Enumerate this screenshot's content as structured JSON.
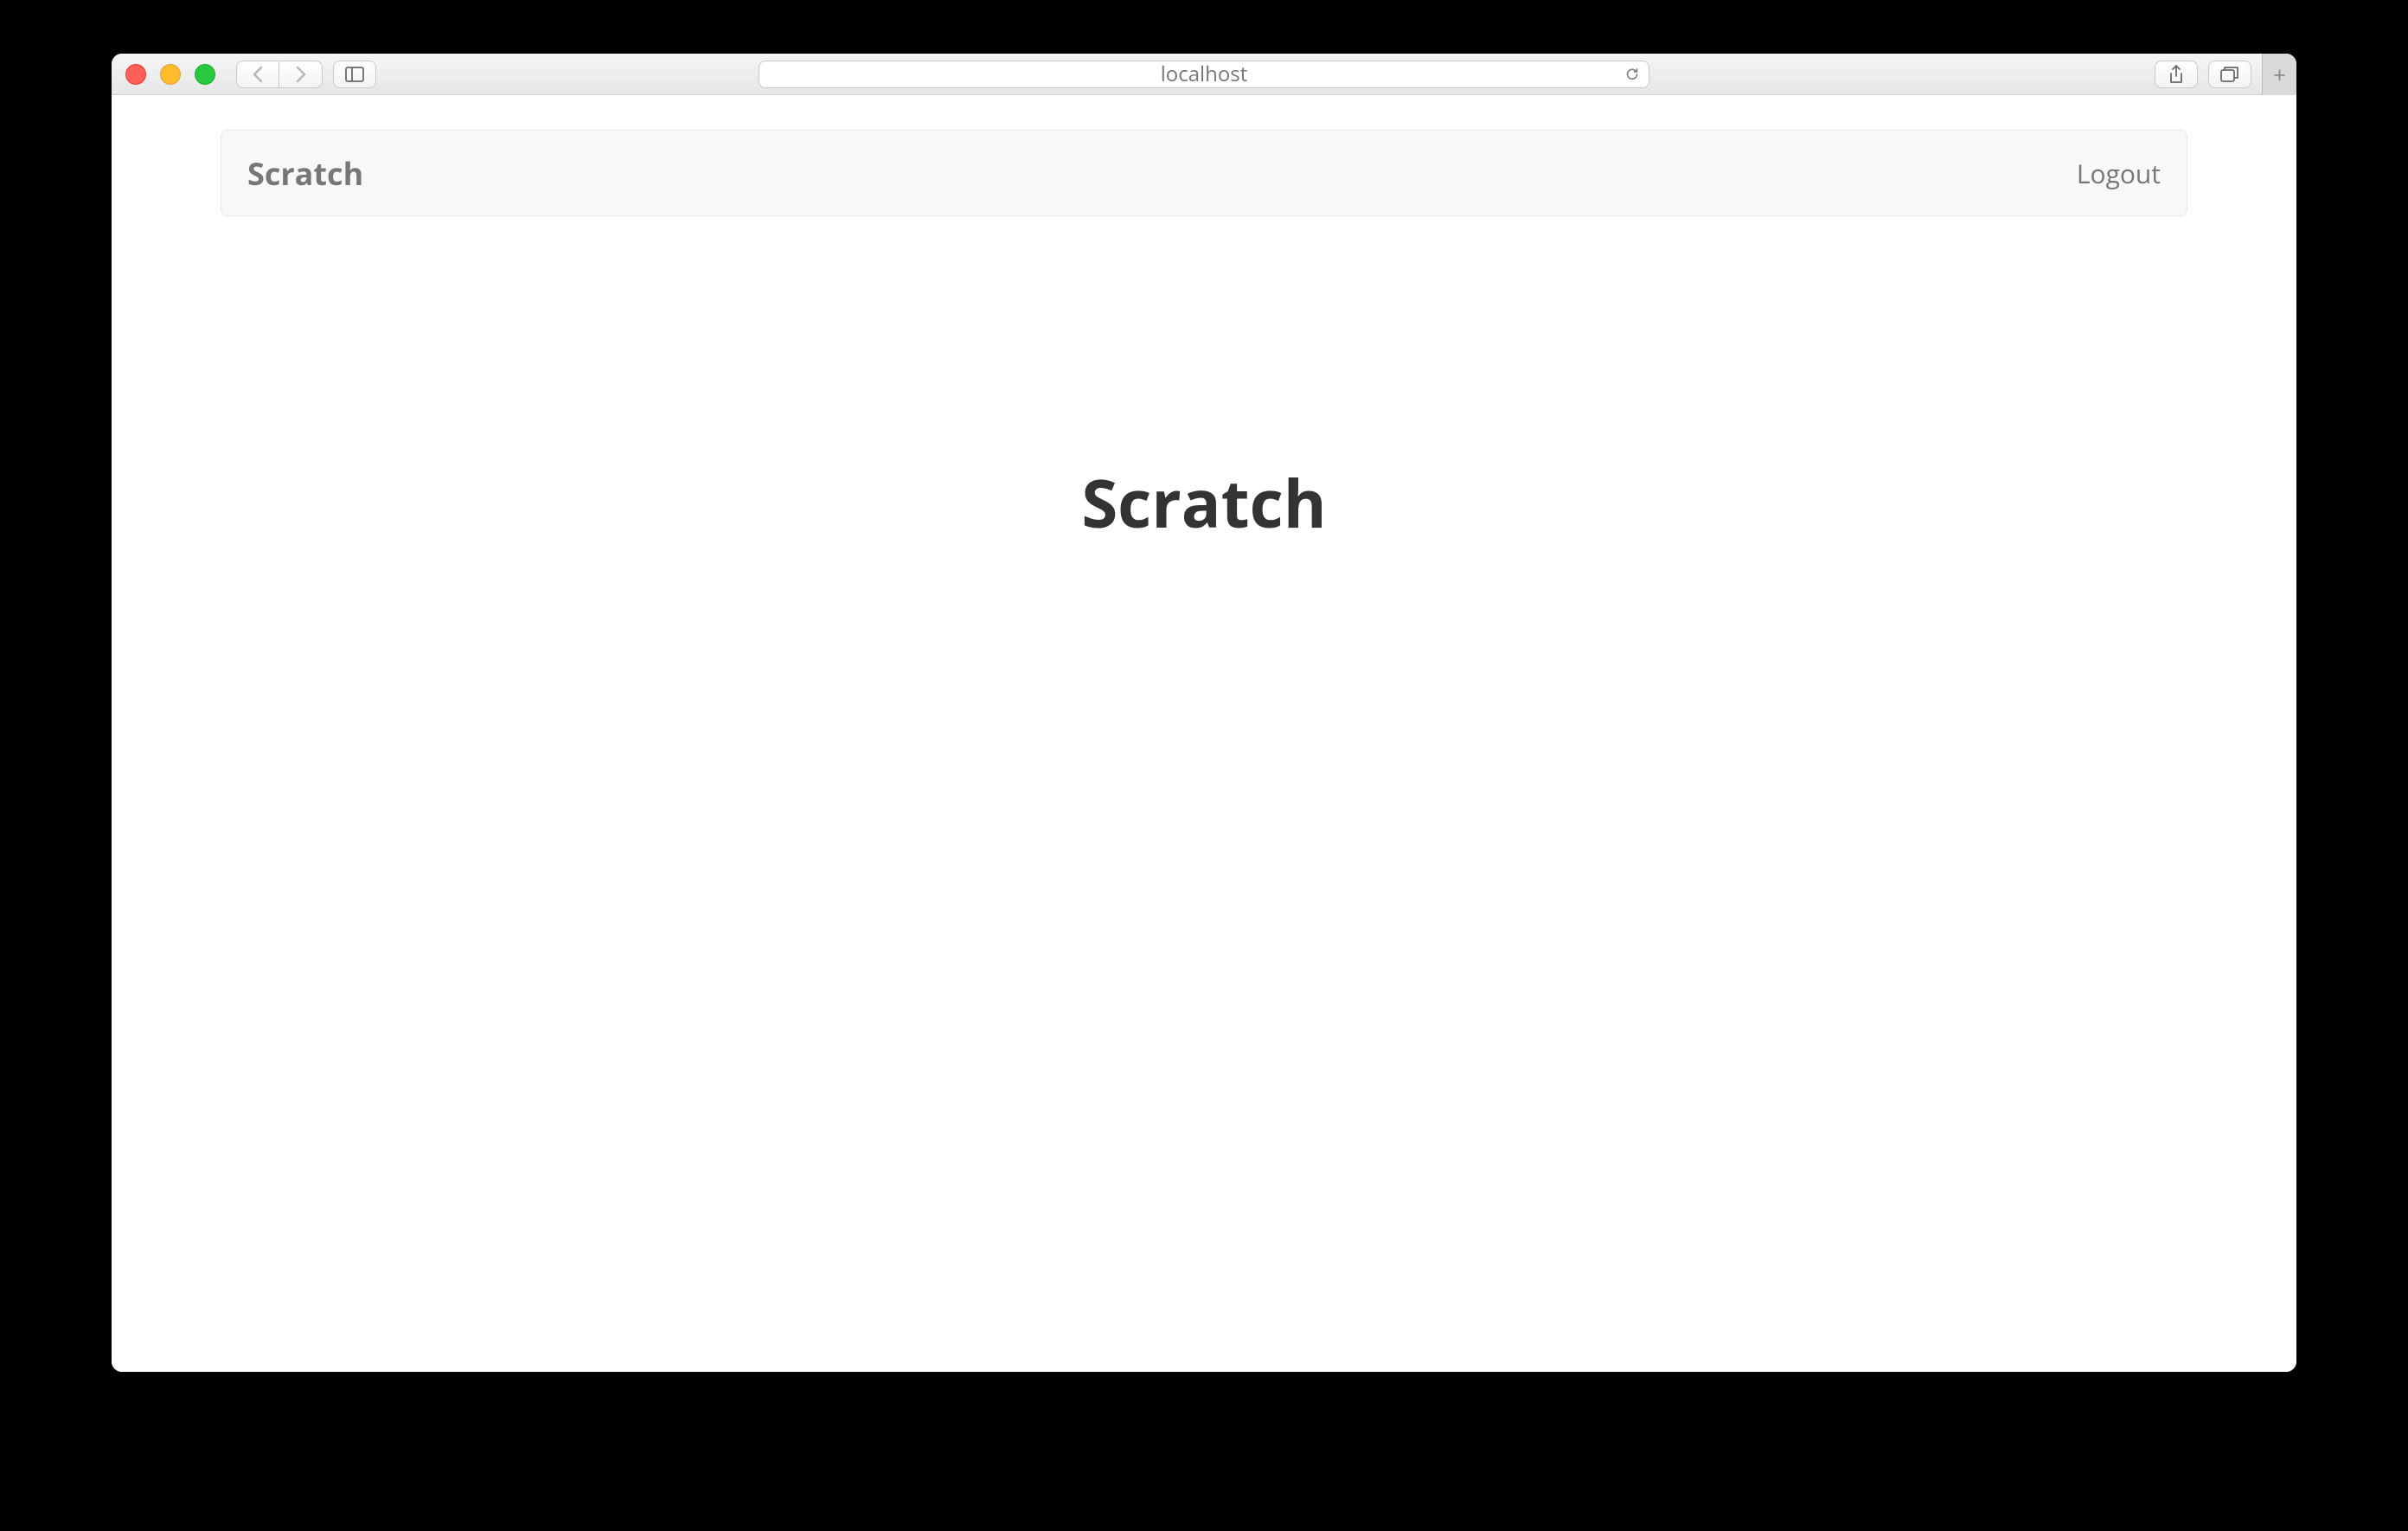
{
  "browser": {
    "address": "localhost"
  },
  "navbar": {
    "brand": "Scratch",
    "logout_label": "Logout"
  },
  "main": {
    "heading": "Scratch"
  }
}
